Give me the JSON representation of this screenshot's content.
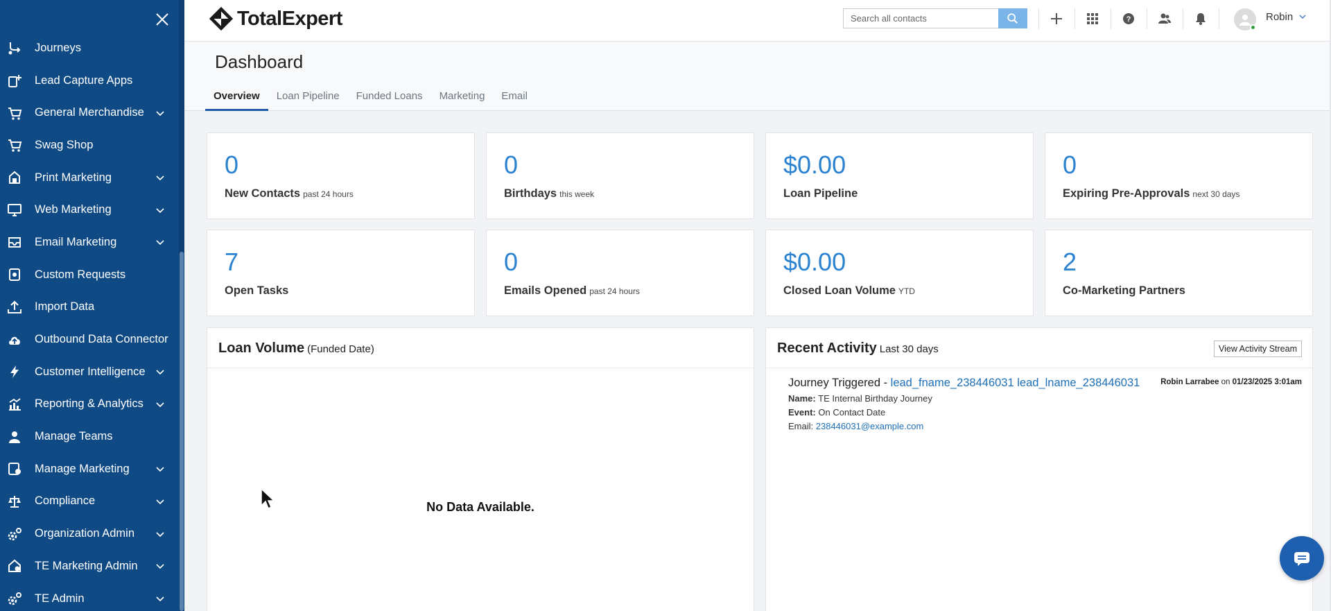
{
  "sidebar": {
    "items": [
      {
        "label": "Journeys",
        "icon": "journey-icon",
        "expandable": false
      },
      {
        "label": "Lead Capture Apps",
        "icon": "lead-capture-icon",
        "expandable": false
      },
      {
        "label": "General Merchandise",
        "icon": "cart-icon",
        "expandable": true
      },
      {
        "label": "Swag Shop",
        "icon": "cart-icon",
        "expandable": false
      },
      {
        "label": "Print Marketing",
        "icon": "print-icon",
        "expandable": true
      },
      {
        "label": "Web Marketing",
        "icon": "monitor-icon",
        "expandable": true
      },
      {
        "label": "Email Marketing",
        "icon": "email-icon",
        "expandable": true
      },
      {
        "label": "Custom Requests",
        "icon": "custom-request-icon",
        "expandable": false
      },
      {
        "label": "Import Data",
        "icon": "upload-icon",
        "expandable": false
      },
      {
        "label": "Outbound Data Connector",
        "icon": "cloud-upload-icon",
        "expandable": false
      },
      {
        "label": "Customer Intelligence",
        "icon": "lightning-icon",
        "expandable": true
      },
      {
        "label": "Reporting & Analytics",
        "icon": "chart-icon",
        "expandable": true
      },
      {
        "label": "Manage Teams",
        "icon": "person-icon",
        "expandable": false
      },
      {
        "label": "Manage Marketing",
        "icon": "manage-marketing-icon",
        "expandable": true
      },
      {
        "label": "Compliance",
        "icon": "scale-icon",
        "expandable": true
      },
      {
        "label": "Organization Admin",
        "icon": "gears-icon",
        "expandable": true
      },
      {
        "label": "TE Marketing Admin",
        "icon": "admin-building-icon",
        "expandable": true
      },
      {
        "label": "TE Admin",
        "icon": "gears-icon",
        "expandable": true
      }
    ]
  },
  "header": {
    "logo_text": "TotalExpert",
    "search_placeholder": "Search all contacts",
    "user_name": "Robin"
  },
  "page": {
    "title": "Dashboard",
    "tabs": [
      "Overview",
      "Loan Pipeline",
      "Funded Loans",
      "Marketing",
      "Email"
    ],
    "active_tab": "Overview"
  },
  "stats": [
    {
      "value": "0",
      "label": "New Contacts",
      "sub": "past 24 hours"
    },
    {
      "value": "0",
      "label": "Birthdays",
      "sub": "this week"
    },
    {
      "value": "$0.00",
      "label": "Loan Pipeline",
      "sub": ""
    },
    {
      "value": "0",
      "label": "Expiring Pre-Approvals",
      "sub": "next 30 days"
    },
    {
      "value": "7",
      "label": "Open Tasks",
      "sub": ""
    },
    {
      "value": "0",
      "label": "Emails Opened",
      "sub": "past 24 hours"
    },
    {
      "value": "$0.00",
      "label": "Closed Loan Volume",
      "sub": "YTD"
    },
    {
      "value": "2",
      "label": "Co-Marketing Partners",
      "sub": ""
    }
  ],
  "loan_volume": {
    "title": "Loan Volume",
    "subtitle": "(Funded Date)",
    "empty_text": "No Data Available."
  },
  "recent_activity": {
    "title": "Recent Activity",
    "subtitle": "Last 30 days",
    "button": "View Activity Stream",
    "items": [
      {
        "type": "Journey Triggered - ",
        "contact": "lead_fname_238446031 lead_lname_238446031",
        "actor": "Robin Larrabee",
        "on": " on ",
        "when": "01/23/2025 3:01am",
        "name_label": "Name:",
        "name_value": "TE Internal Birthday Journey",
        "event_label": "Event:",
        "event_value": "On Contact Date",
        "email_label": "Email:",
        "email_value": "238446031@example.com"
      }
    ]
  },
  "colors": {
    "sidebar": "#0f4a85",
    "accent": "#2a82d0",
    "link": "#1d6fb8"
  }
}
